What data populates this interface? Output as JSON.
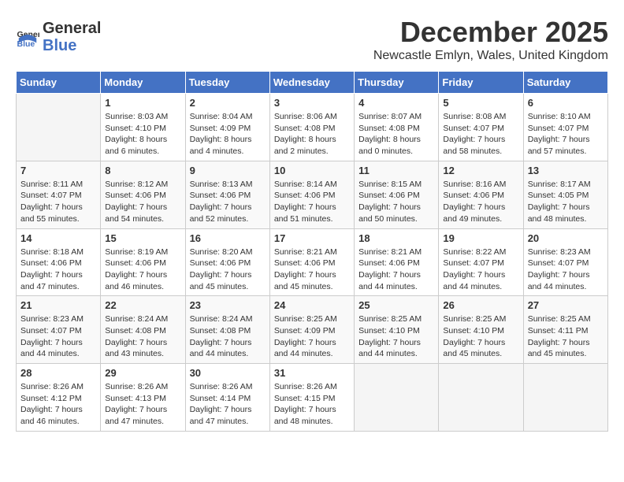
{
  "header": {
    "logo_line1": "General",
    "logo_line2": "Blue",
    "month": "December 2025",
    "location": "Newcastle Emlyn, Wales, United Kingdom"
  },
  "weekdays": [
    "Sunday",
    "Monday",
    "Tuesday",
    "Wednesday",
    "Thursday",
    "Friday",
    "Saturday"
  ],
  "weeks": [
    [
      {
        "day": "",
        "info": ""
      },
      {
        "day": "1",
        "info": "Sunrise: 8:03 AM\nSunset: 4:10 PM\nDaylight: 8 hours\nand 6 minutes."
      },
      {
        "day": "2",
        "info": "Sunrise: 8:04 AM\nSunset: 4:09 PM\nDaylight: 8 hours\nand 4 minutes."
      },
      {
        "day": "3",
        "info": "Sunrise: 8:06 AM\nSunset: 4:08 PM\nDaylight: 8 hours\nand 2 minutes."
      },
      {
        "day": "4",
        "info": "Sunrise: 8:07 AM\nSunset: 4:08 PM\nDaylight: 8 hours\nand 0 minutes."
      },
      {
        "day": "5",
        "info": "Sunrise: 8:08 AM\nSunset: 4:07 PM\nDaylight: 7 hours\nand 58 minutes."
      },
      {
        "day": "6",
        "info": "Sunrise: 8:10 AM\nSunset: 4:07 PM\nDaylight: 7 hours\nand 57 minutes."
      }
    ],
    [
      {
        "day": "7",
        "info": "Sunrise: 8:11 AM\nSunset: 4:07 PM\nDaylight: 7 hours\nand 55 minutes."
      },
      {
        "day": "8",
        "info": "Sunrise: 8:12 AM\nSunset: 4:06 PM\nDaylight: 7 hours\nand 54 minutes."
      },
      {
        "day": "9",
        "info": "Sunrise: 8:13 AM\nSunset: 4:06 PM\nDaylight: 7 hours\nand 52 minutes."
      },
      {
        "day": "10",
        "info": "Sunrise: 8:14 AM\nSunset: 4:06 PM\nDaylight: 7 hours\nand 51 minutes."
      },
      {
        "day": "11",
        "info": "Sunrise: 8:15 AM\nSunset: 4:06 PM\nDaylight: 7 hours\nand 50 minutes."
      },
      {
        "day": "12",
        "info": "Sunrise: 8:16 AM\nSunset: 4:06 PM\nDaylight: 7 hours\nand 49 minutes."
      },
      {
        "day": "13",
        "info": "Sunrise: 8:17 AM\nSunset: 4:05 PM\nDaylight: 7 hours\nand 48 minutes."
      }
    ],
    [
      {
        "day": "14",
        "info": "Sunrise: 8:18 AM\nSunset: 4:06 PM\nDaylight: 7 hours\nand 47 minutes."
      },
      {
        "day": "15",
        "info": "Sunrise: 8:19 AM\nSunset: 4:06 PM\nDaylight: 7 hours\nand 46 minutes."
      },
      {
        "day": "16",
        "info": "Sunrise: 8:20 AM\nSunset: 4:06 PM\nDaylight: 7 hours\nand 45 minutes."
      },
      {
        "day": "17",
        "info": "Sunrise: 8:21 AM\nSunset: 4:06 PM\nDaylight: 7 hours\nand 45 minutes."
      },
      {
        "day": "18",
        "info": "Sunrise: 8:21 AM\nSunset: 4:06 PM\nDaylight: 7 hours\nand 44 minutes."
      },
      {
        "day": "19",
        "info": "Sunrise: 8:22 AM\nSunset: 4:07 PM\nDaylight: 7 hours\nand 44 minutes."
      },
      {
        "day": "20",
        "info": "Sunrise: 8:23 AM\nSunset: 4:07 PM\nDaylight: 7 hours\nand 44 minutes."
      }
    ],
    [
      {
        "day": "21",
        "info": "Sunrise: 8:23 AM\nSunset: 4:07 PM\nDaylight: 7 hours\nand 44 minutes."
      },
      {
        "day": "22",
        "info": "Sunrise: 8:24 AM\nSunset: 4:08 PM\nDaylight: 7 hours\nand 43 minutes."
      },
      {
        "day": "23",
        "info": "Sunrise: 8:24 AM\nSunset: 4:08 PM\nDaylight: 7 hours\nand 44 minutes."
      },
      {
        "day": "24",
        "info": "Sunrise: 8:25 AM\nSunset: 4:09 PM\nDaylight: 7 hours\nand 44 minutes."
      },
      {
        "day": "25",
        "info": "Sunrise: 8:25 AM\nSunset: 4:10 PM\nDaylight: 7 hours\nand 44 minutes."
      },
      {
        "day": "26",
        "info": "Sunrise: 8:25 AM\nSunset: 4:10 PM\nDaylight: 7 hours\nand 45 minutes."
      },
      {
        "day": "27",
        "info": "Sunrise: 8:25 AM\nSunset: 4:11 PM\nDaylight: 7 hours\nand 45 minutes."
      }
    ],
    [
      {
        "day": "28",
        "info": "Sunrise: 8:26 AM\nSunset: 4:12 PM\nDaylight: 7 hours\nand 46 minutes."
      },
      {
        "day": "29",
        "info": "Sunrise: 8:26 AM\nSunset: 4:13 PM\nDaylight: 7 hours\nand 47 minutes."
      },
      {
        "day": "30",
        "info": "Sunrise: 8:26 AM\nSunset: 4:14 PM\nDaylight: 7 hours\nand 47 minutes."
      },
      {
        "day": "31",
        "info": "Sunrise: 8:26 AM\nSunset: 4:15 PM\nDaylight: 7 hours\nand 48 minutes."
      },
      {
        "day": "",
        "info": ""
      },
      {
        "day": "",
        "info": ""
      },
      {
        "day": "",
        "info": ""
      }
    ]
  ]
}
